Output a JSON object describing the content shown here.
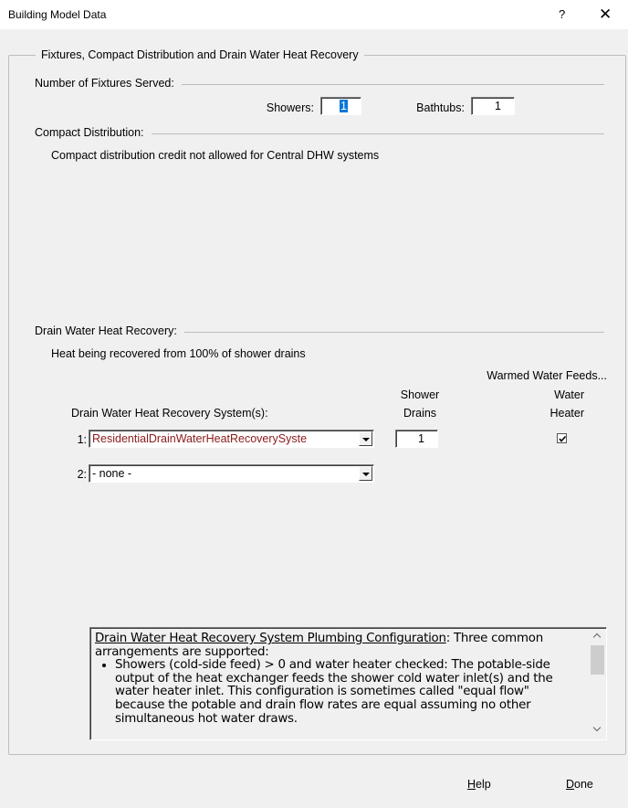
{
  "window": {
    "title": "Building Model Data",
    "help_glyph": "?",
    "close_glyph": "✕"
  },
  "group": {
    "legend": "Fixtures, Compact Distribution and Drain Water Heat Recovery"
  },
  "fixtures": {
    "heading": "Number of Fixtures Served:",
    "showers_label": "Showers:",
    "showers_value": "1",
    "bathtubs_label": "Bathtubs:",
    "bathtubs_value": "1"
  },
  "compact": {
    "heading": "Compact Distribution:",
    "message": "Compact distribution credit not allowed for Central DHW systems"
  },
  "dwhr": {
    "heading": "Drain Water Heat Recovery:",
    "recovered_text": "Heat being recovered from 100% of shower drains",
    "warmed_header": "Warmed Water Feeds...",
    "shower_header_line1": "Shower",
    "shower_header_line2": "Drains",
    "water_header_line1": "Water",
    "water_header_line2": "Heater",
    "systems_label": "Drain Water Heat Recovery System(s):",
    "rows": [
      {
        "index": "1:",
        "system": "ResidentialDrainWaterHeatRecoverySyste",
        "shower_drains": "1",
        "water_heater_checked": true
      },
      {
        "index": "2:",
        "system": "- none -"
      }
    ]
  },
  "info": {
    "title": "Drain Water Heat Recovery System Plumbing Configuration",
    "intro": ":  Three common arrangements are supported:",
    "bullet1": "Showers (cold-side feed) > 0 and water heater checked:  The potable-side output of the heat exchanger feeds the shower cold water inlet(s) and the water heater inlet.  This configuration is sometimes called \"equal flow\" because the potable and drain flow rates are equal assuming no other simultaneous hot water draws."
  },
  "buttons": {
    "help_mnemonic": "H",
    "help_rest": "elp",
    "done_mnemonic": "D",
    "done_rest": "one"
  },
  "colors": {
    "system_text": "#8b1a1a",
    "selection": "#0078d7"
  }
}
